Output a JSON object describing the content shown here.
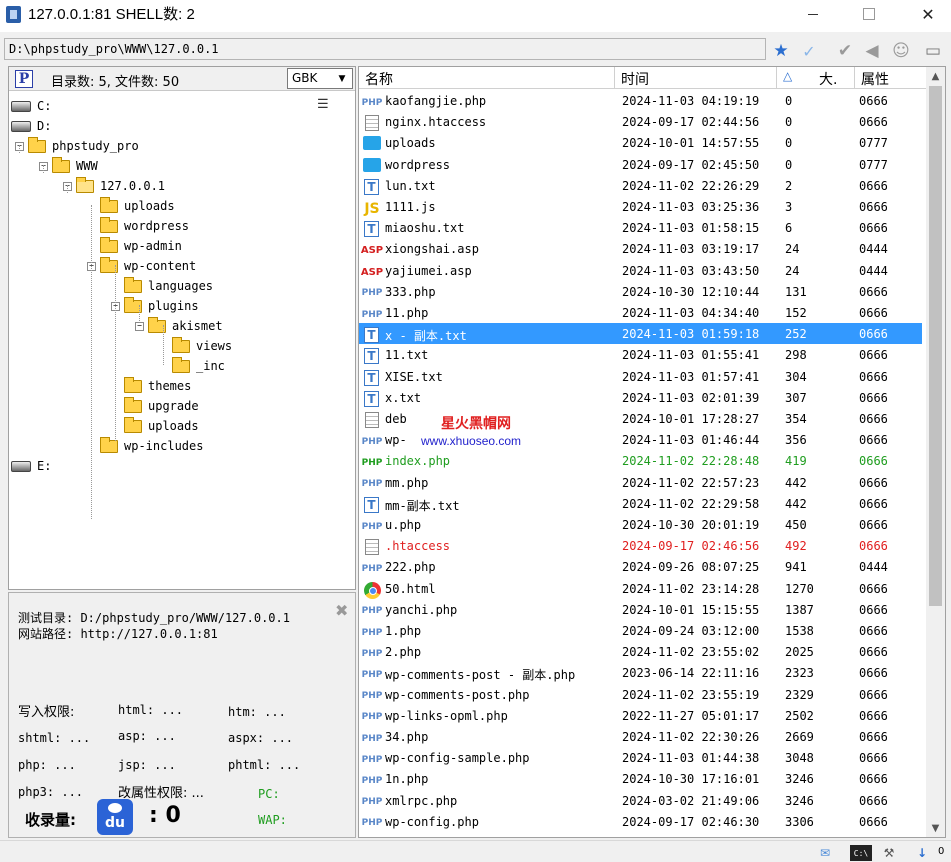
{
  "window": {
    "title": "127.0.0.1:81 SHELL数: 2"
  },
  "path_bar": {
    "path": "D:\\phpstudy_pro\\WWW\\127.0.0.1"
  },
  "left_panel": {
    "summary": "目录数: 5, 文件数: 50",
    "encoding": "GBK",
    "tree": [
      {
        "label": "C:",
        "type": "drive"
      },
      {
        "label": "D:",
        "type": "drive"
      },
      {
        "label": "phpstudy_pro",
        "type": "folder",
        "expander": "−"
      },
      {
        "label": "WWW",
        "type": "folder",
        "expander": "−"
      },
      {
        "label": "127.0.0.1",
        "type": "folder-open",
        "expander": "−"
      },
      {
        "label": "uploads",
        "type": "folder"
      },
      {
        "label": "wordpress",
        "type": "folder"
      },
      {
        "label": "wp-admin",
        "type": "folder"
      },
      {
        "label": "wp-content",
        "type": "folder",
        "expander": "−"
      },
      {
        "label": "languages",
        "type": "folder"
      },
      {
        "label": "plugins",
        "type": "folder",
        "expander": "−"
      },
      {
        "label": "akismet",
        "type": "folder",
        "expander": "−"
      },
      {
        "label": "views",
        "type": "folder"
      },
      {
        "label": "_inc",
        "type": "folder"
      },
      {
        "label": "themes",
        "type": "folder"
      },
      {
        "label": "upgrade",
        "type": "folder"
      },
      {
        "label": "uploads",
        "type": "folder"
      },
      {
        "label": "wp-includes",
        "type": "folder"
      },
      {
        "label": "E:",
        "type": "drive"
      }
    ]
  },
  "info_panel": {
    "test_dir": "测试目录: D:/phpstudy_pro/WWW/127.0.0.1",
    "site_path": "网站路径: http://127.0.0.1:81",
    "write_perm": "写入权限:",
    "html": "html: ...",
    "htm": "htm: ...",
    "shtml": "shtml: ...",
    "asp": "asp: ...",
    "aspx": "aspx: ...",
    "php": "php: ...",
    "jsp": "jsp: ...",
    "phtml": "phtml: ...",
    "php3": "php3: ...",
    "attr_perm": "改属性权限: ...",
    "pc": "PC:",
    "wap": "WAP:",
    "indexed_label": "收录量:",
    "baidu_logo_text": "du",
    "indexed_value": ": 0"
  },
  "file_list": {
    "columns": {
      "name": "名称",
      "time": "时间",
      "size": "大.",
      "attr": "属性"
    },
    "rows": [
      {
        "icon": "php",
        "name": "kaofangjie.php",
        "time": "2024-11-03 04:19:19",
        "size": "0",
        "attr": "0666"
      },
      {
        "icon": "doc",
        "name": "nginx.htaccess",
        "time": "2024-09-17 02:44:56",
        "size": "0",
        "attr": "0666"
      },
      {
        "icon": "folder",
        "name": "uploads",
        "time": "2024-10-01 14:57:55",
        "size": "0",
        "attr": "0777"
      },
      {
        "icon": "folder",
        "name": "wordpress",
        "time": "2024-09-17 02:45:50",
        "size": "0",
        "attr": "0777"
      },
      {
        "icon": "txt",
        "name": "lun.txt",
        "time": "2024-11-02 22:26:29",
        "size": "2",
        "attr": "0666"
      },
      {
        "icon": "js",
        "name": "1111.js",
        "time": "2024-11-03 03:25:36",
        "size": "3",
        "attr": "0666"
      },
      {
        "icon": "txt",
        "name": "miaoshu.txt",
        "time": "2024-11-03 01:58:15",
        "size": "6",
        "attr": "0666"
      },
      {
        "icon": "asp",
        "name": "xiongshai.asp",
        "time": "2024-11-03 03:19:17",
        "size": "24",
        "attr": "0444"
      },
      {
        "icon": "asp",
        "name": "yajiumei.asp",
        "time": "2024-11-03 03:43:50",
        "size": "24",
        "attr": "0444"
      },
      {
        "icon": "php",
        "name": "333.php",
        "time": "2024-10-30 12:10:44",
        "size": "131",
        "attr": "0666"
      },
      {
        "icon": "php",
        "name": "11.php",
        "time": "2024-11-03 04:34:40",
        "size": "152",
        "attr": "0666"
      },
      {
        "icon": "txt",
        "name": "x - 副本.txt",
        "time": "2024-11-03 01:59:18",
        "size": "252",
        "attr": "0666",
        "state": "selected"
      },
      {
        "icon": "txt",
        "name": "11.txt",
        "time": "2024-11-03 01:55:41",
        "size": "298",
        "attr": "0666"
      },
      {
        "icon": "txt",
        "name": "XISE.txt",
        "time": "2024-11-03 01:57:41",
        "size": "304",
        "attr": "0666"
      },
      {
        "icon": "txt",
        "name": "x.txt",
        "time": "2024-11-03 02:01:39",
        "size": "307",
        "attr": "0666"
      },
      {
        "icon": "doc",
        "name": "deb",
        "time": "2024-10-01 17:28:27",
        "size": "354",
        "attr": "0666"
      },
      {
        "icon": "php",
        "name": "wp-",
        "time": "2024-11-03 01:46:44",
        "size": "356",
        "attr": "0666"
      },
      {
        "icon": "php",
        "name": "index.php",
        "time": "2024-11-02 22:28:48",
        "size": "419",
        "attr": "0666",
        "state": "green"
      },
      {
        "icon": "php",
        "name": "mm.php",
        "time": "2024-11-02 22:57:23",
        "size": "442",
        "attr": "0666"
      },
      {
        "icon": "txt",
        "name": "mm-副本.txt",
        "time": "2024-11-02 22:29:58",
        "size": "442",
        "attr": "0666"
      },
      {
        "icon": "php",
        "name": "u.php",
        "time": "2024-10-30 20:01:19",
        "size": "450",
        "attr": "0666"
      },
      {
        "icon": "doc",
        "name": ".htaccess",
        "time": "2024-09-17 02:46:56",
        "size": "492",
        "attr": "0666",
        "state": "red"
      },
      {
        "icon": "php",
        "name": "222.php",
        "time": "2024-09-26 08:07:25",
        "size": "941",
        "attr": "0444"
      },
      {
        "icon": "chrome",
        "name": "50.html",
        "time": "2024-11-02 23:14:28",
        "size": "1270",
        "attr": "0666"
      },
      {
        "icon": "php",
        "name": "yanchi.php",
        "time": "2024-10-01 15:15:55",
        "size": "1387",
        "attr": "0666"
      },
      {
        "icon": "php",
        "name": "1.php",
        "time": "2024-09-24 03:12:00",
        "size": "1538",
        "attr": "0666"
      },
      {
        "icon": "php",
        "name": "2.php",
        "time": "2024-11-02 23:55:02",
        "size": "2025",
        "attr": "0666"
      },
      {
        "icon": "php",
        "name": "wp-comments-post - 副本.php",
        "time": "2023-06-14 22:11:16",
        "size": "2323",
        "attr": "0666"
      },
      {
        "icon": "php",
        "name": "wp-comments-post.php",
        "time": "2024-11-02 23:55:19",
        "size": "2329",
        "attr": "0666"
      },
      {
        "icon": "php",
        "name": "wp-links-opml.php",
        "time": "2022-11-27 05:01:17",
        "size": "2502",
        "attr": "0666"
      },
      {
        "icon": "php",
        "name": "34.php",
        "time": "2024-11-02 22:30:26",
        "size": "2669",
        "attr": "0666"
      },
      {
        "icon": "php",
        "name": "wp-config-sample.php",
        "time": "2024-11-03 01:44:38",
        "size": "3048",
        "attr": "0666"
      },
      {
        "icon": "php",
        "name": "1n.php",
        "time": "2024-10-30 17:16:01",
        "size": "3246",
        "attr": "0666"
      },
      {
        "icon": "php",
        "name": "xmlrpc.php",
        "time": "2024-03-02 21:49:06",
        "size": "3246",
        "attr": "0666"
      },
      {
        "icon": "php",
        "name": "wp-config.php",
        "time": "2024-09-17 02:46:30",
        "size": "3306",
        "attr": "0666"
      }
    ]
  },
  "watermark": {
    "title": "星火黑帽网",
    "url": "www.xhuoseo.com"
  },
  "icon_labels": {
    "php": "PHP",
    "txt": "T",
    "js": "JS",
    "asp": "ASP",
    "cmd": "C:\\"
  },
  "status_bar": {
    "count": "0"
  }
}
